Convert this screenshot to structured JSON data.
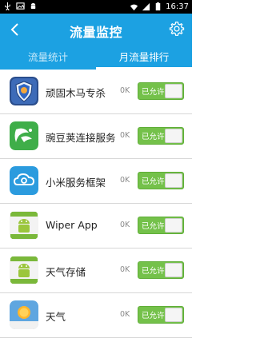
{
  "status_bar": {
    "time": "16:37",
    "left_icons": [
      "usb-icon",
      "image-icon",
      "android-icon"
    ],
    "right_icons": [
      "wifi-icon",
      "signal-icon",
      "battery-icon"
    ]
  },
  "header": {
    "title": "流量监控",
    "back_icon": "chevron-left-icon",
    "settings_icon": "gear-icon"
  },
  "tabs": [
    {
      "label": "流量统计",
      "active": false
    },
    {
      "label": "月流量排行",
      "active": true
    }
  ],
  "apps": [
    {
      "name": "顽固木马专杀",
      "traffic": "0K",
      "toggle_label": "已允许",
      "icon": "shield-app-icon"
    },
    {
      "name": "豌豆荚连接服务",
      "traffic": "0K",
      "toggle_label": "已允许",
      "icon": "wandoujia-icon"
    },
    {
      "name": "小米服务框架",
      "traffic": "0K",
      "toggle_label": "已允许",
      "icon": "cloud-app-icon"
    },
    {
      "name": "Wiper App",
      "traffic": "0K",
      "toggle_label": "已允许",
      "icon": "android-app-icon"
    },
    {
      "name": "天气存储",
      "traffic": "0K",
      "toggle_label": "已允许",
      "icon": "android-app-icon"
    },
    {
      "name": "天气",
      "traffic": "0K",
      "toggle_label": "已允许",
      "icon": "weather-app-icon"
    }
  ],
  "colors": {
    "accent": "#1ca1e2",
    "toggle_on": "#74c14a",
    "status_bar": "#000000"
  }
}
